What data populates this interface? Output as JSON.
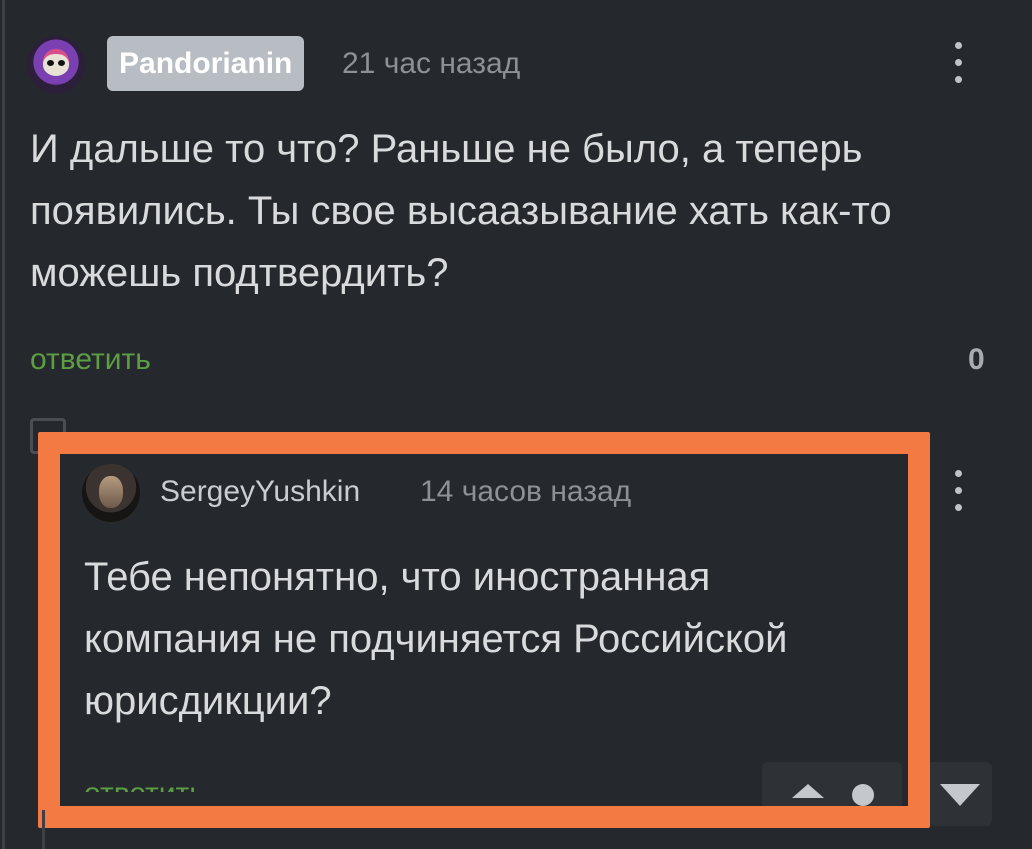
{
  "comment1": {
    "username": "Pandorianin",
    "time": "21 час назад",
    "text": "И дальше то что? Раньше не было, а теперь появились. Ты свое высаазывание хать как-то можешь подтвердить?",
    "reply_label": "ответить",
    "score": "0"
  },
  "comment2": {
    "username": "SergeyYushkin",
    "time": "14 часов назад",
    "text": "Тебе непонятно, что иностранная компания не подчиняется Российской юрисдикции?",
    "reply_label": "ответить"
  },
  "icons": {
    "menu": "more-vertical-icon",
    "collapse": "collapse-minus-icon",
    "upvote": "upvote-icon",
    "downvote": "downvote-icon"
  },
  "colors": {
    "background": "#25282c",
    "reply_link": "#5c9e44",
    "highlight": "#f47a43",
    "badge": "#b8bcc3"
  }
}
